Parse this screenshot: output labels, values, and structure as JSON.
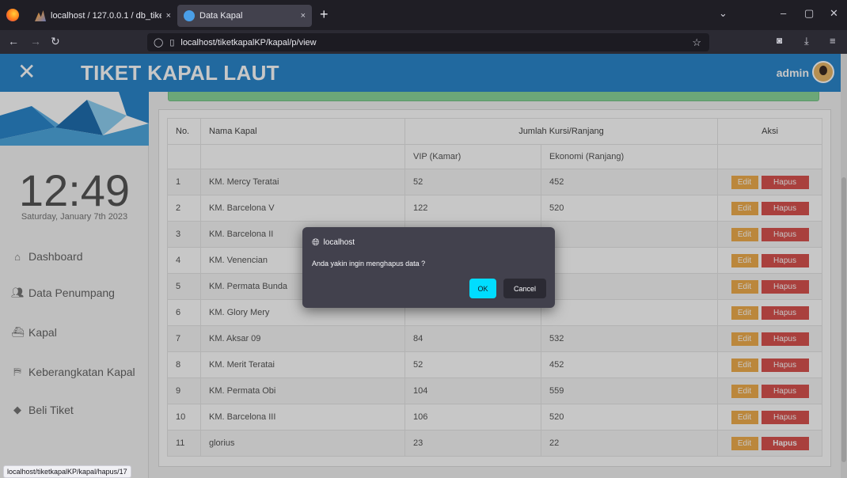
{
  "browser": {
    "tabs": [
      {
        "title": "localhost / 127.0.0.1 / db_tiketk",
        "close": "×"
      },
      {
        "title": "Data Kapal",
        "close": "×"
      }
    ],
    "new_tab": "+",
    "url": "localhost/tiketkapalKP/kapal/p/view",
    "status_url": "localhost/tiketkapalKP/kapal/hapus/17"
  },
  "header": {
    "title": "TIKET KAPAL LAUT",
    "close": "✕",
    "user": "admin"
  },
  "sidebar": {
    "clock": "12:49",
    "date": "Saturday, January 7th 2023",
    "items": [
      {
        "label": "Dashboard",
        "icon": "home-icon"
      },
      {
        "label": "Data Penumpang",
        "icon": "users-icon"
      },
      {
        "label": "Kapal",
        "icon": "ship-icon"
      },
      {
        "label": "Keberangkatan Kapal",
        "icon": "departure-icon"
      },
      {
        "label": "Beli Tiket",
        "icon": "ticket-icon"
      }
    ]
  },
  "table": {
    "col_no": "No.",
    "col_name": "Nama Kapal",
    "col_group": "Jumlah Kursi/Ranjang",
    "col_action": "Aksi",
    "sub_vip": "VIP (Kamar)",
    "sub_eko": "Ekonomi (Ranjang)",
    "edit_label": "Edit",
    "delete_label": "Hapus",
    "rows": [
      {
        "no": "1",
        "name": "KM. Mercy Teratai",
        "vip": "52",
        "eko": "452"
      },
      {
        "no": "2",
        "name": "KM. Barcelona V",
        "vip": "122",
        "eko": "520"
      },
      {
        "no": "3",
        "name": "KM. Barcelona II",
        "vip": "",
        "eko": ""
      },
      {
        "no": "4",
        "name": "KM. Venencian",
        "vip": "",
        "eko": ""
      },
      {
        "no": "5",
        "name": "KM. Permata Bunda",
        "vip": "",
        "eko": ""
      },
      {
        "no": "6",
        "name": "KM. Glory Mery",
        "vip": "",
        "eko": ""
      },
      {
        "no": "7",
        "name": "KM. Aksar 09",
        "vip": "84",
        "eko": "532"
      },
      {
        "no": "8",
        "name": "KM. Merit Teratai",
        "vip": "52",
        "eko": "452"
      },
      {
        "no": "9",
        "name": "KM. Permata Obi",
        "vip": "104",
        "eko": "559"
      },
      {
        "no": "10",
        "name": "KM. Barcelona III",
        "vip": "106",
        "eko": "520"
      },
      {
        "no": "11",
        "name": "glorius",
        "vip": "23",
        "eko": "22"
      }
    ]
  },
  "dialog": {
    "origin": "localhost",
    "message": "Anda yakin ingin menghapus data ?",
    "ok": "OK",
    "cancel": "Cancel"
  },
  "colors": {
    "header": "#2b87cc",
    "edit": "#f0ad4e",
    "delete": "#d9534f",
    "ok": "#00ddff"
  }
}
